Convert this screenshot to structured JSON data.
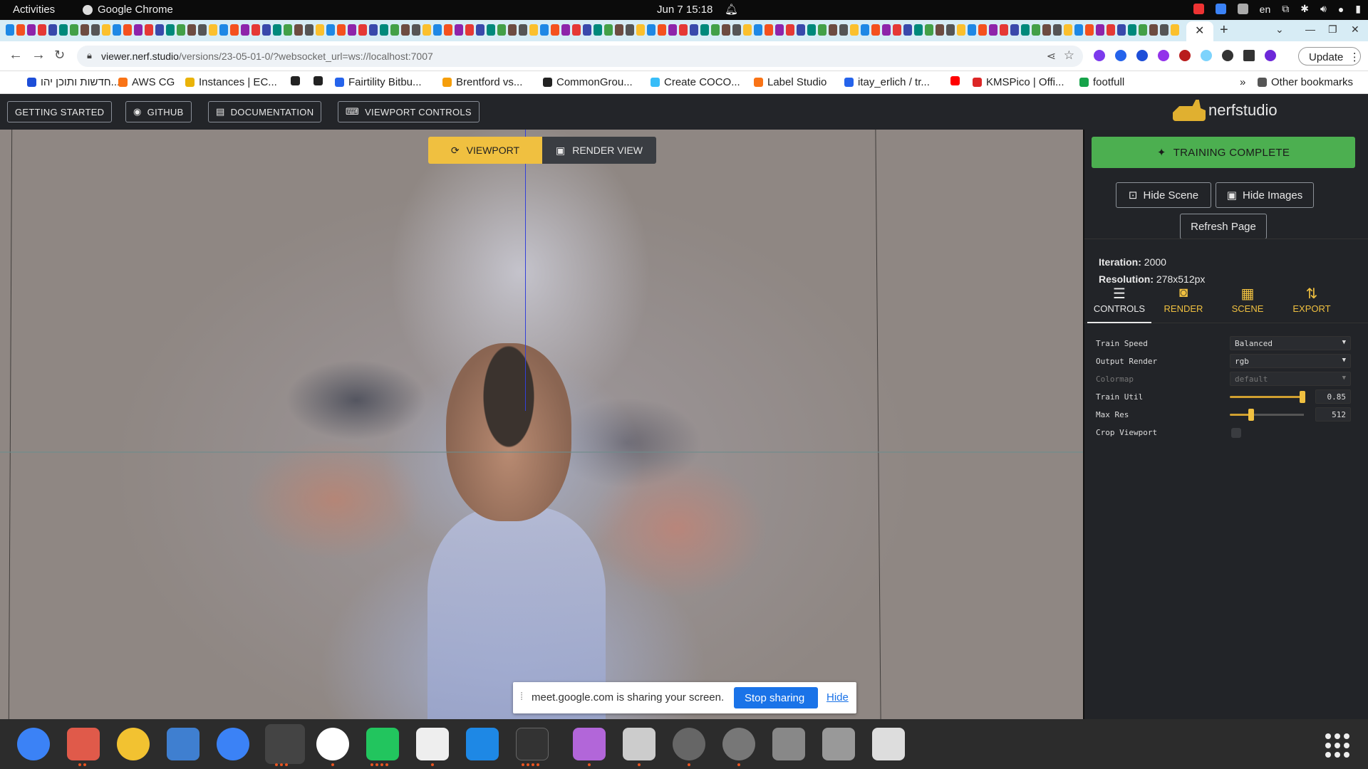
{
  "system_bar": {
    "activities": "Activities",
    "app_name": "Google Chrome",
    "clock": "Jun 7  15:18",
    "language": "en"
  },
  "browser": {
    "url_host": "viewer.nerf.studio",
    "url_path": "/versions/23-05-01-0/?websocket_url=ws://localhost:7007",
    "update_label": "Update",
    "bookmarks": [
      {
        "label": "חדשות ותוכן יהו...",
        "color": "#1d4ed8"
      },
      {
        "label": "AWS CG",
        "color": "#f97316"
      },
      {
        "label": "Instances | EC...",
        "color": "#eab308"
      },
      {
        "label": "",
        "color": "#222222"
      },
      {
        "label": "",
        "color": "#222222"
      },
      {
        "label": "Fairtility Bitbu...",
        "color": "#2563eb"
      },
      {
        "label": "Brentford vs...",
        "color": "#f59e0b"
      },
      {
        "label": "CommonGrou...",
        "color": "#222222"
      },
      {
        "label": "Create COCO...",
        "color": "#38bdf8"
      },
      {
        "label": "Label Studio",
        "color": "#f97316"
      },
      {
        "label": "itay_erlich / tr...",
        "color": "#2563eb"
      },
      {
        "label": "",
        "color": "#ff0000"
      },
      {
        "label": "KMSPico | Offi...",
        "color": "#dc2626"
      },
      {
        "label": "footfull",
        "color": "#16a34a"
      }
    ],
    "other_bookmarks": "Other bookmarks"
  },
  "header": {
    "getting_started": "GETTING STARTED",
    "github": "GITHUB",
    "documentation": "DOCUMENTATION",
    "viewport_controls": "VIEWPORT CONTROLS",
    "logo_text": "nerfstudio"
  },
  "viewport": {
    "toggle_viewport": "VIEWPORT",
    "toggle_render": "RENDER VIEW"
  },
  "share_bar": {
    "message": "meet.google.com is sharing your screen.",
    "stop_label": "Stop sharing",
    "hide_label": "Hide"
  },
  "panel": {
    "status": "TRAINING COMPLETE",
    "hide_scene": "Hide Scene",
    "hide_images": "Hide Images",
    "refresh_page": "Refresh Page",
    "iteration_label": "Iteration:",
    "iteration_value": "2000",
    "resolution_label": "Resolution:",
    "resolution_value": "278x512px",
    "tabs": [
      "CONTROLS",
      "RENDER",
      "SCENE",
      "EXPORT"
    ],
    "controls": {
      "train_speed_label": "Train Speed",
      "train_speed_value": "Balanced",
      "output_render_label": "Output Render",
      "output_render_value": "rgb",
      "colormap_label": "Colormap",
      "colormap_value": "default",
      "train_util_label": "Train Util",
      "train_util_value": "0.85",
      "max_res_label": "Max Res",
      "max_res_value": "512",
      "crop_viewport_label": "Crop Viewport"
    }
  },
  "colors": {
    "accent": "#f0c040",
    "success": "#4caf50",
    "panel_bg": "#222428"
  }
}
